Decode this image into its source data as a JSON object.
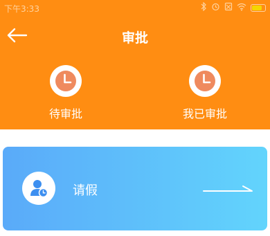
{
  "status_bar": {
    "time": "下午3:33",
    "icons": [
      "bluetooth-icon",
      "alarm-icon",
      "sim-off-icon",
      "wifi-icon",
      "battery-icon"
    ]
  },
  "header": {
    "title": "审批",
    "back_icon": "back-arrow-icon"
  },
  "tabs": [
    {
      "label": "待审批",
      "icon": "clock-icon"
    },
    {
      "label": "我已审批",
      "icon": "clock-icon"
    }
  ],
  "cards": [
    {
      "label": "请假",
      "icon": "user-clock-icon",
      "action_icon": "arrow-right-icon"
    }
  ],
  "colors": {
    "header_bg": "#ff8d12",
    "clock_face": "#ef8a5e",
    "card_gradient_start": "#5aaaf9",
    "card_gradient_end": "#62d4fc",
    "card_icon": "#3d8ff0"
  }
}
